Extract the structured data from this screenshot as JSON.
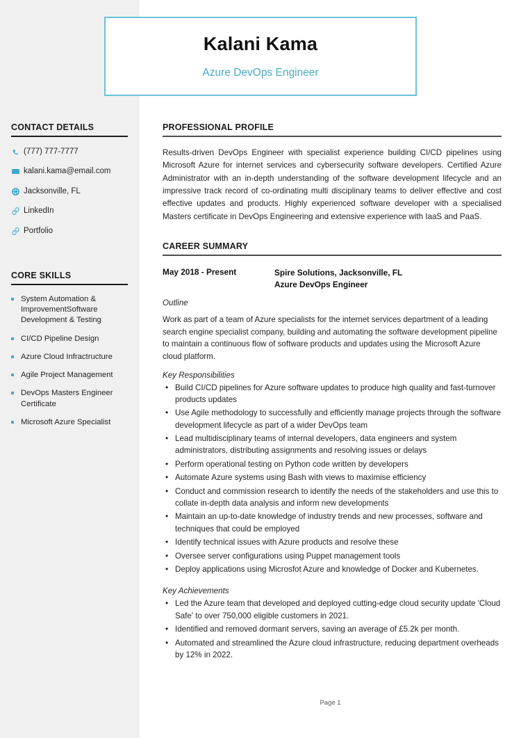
{
  "header": {
    "name": "Kalani Kama",
    "job_title": "Azure DevOps Engineer"
  },
  "accent_color": "#4aa8c4",
  "sidebar": {
    "contact_heading": "CONTACT DETAILS",
    "contact_items": [
      {
        "icon": "phone-icon",
        "value": "(777) 777-7777"
      },
      {
        "icon": "envelope-icon",
        "value": "kalani.kama@email.com"
      },
      {
        "icon": "globe-icon",
        "value": "Jacksonville, FL"
      },
      {
        "icon": "link-icon",
        "value": "LinkedIn"
      },
      {
        "icon": "link-icon",
        "value": "Portfolio"
      }
    ],
    "skills_heading": "CORE SKILLS",
    "skills": [
      "System Automation & ImprovementSoftware Development & Testing",
      "CI/CD Pipeline Design",
      "Azure Cloud Infractructure",
      "Agile Project Management",
      "DevOps Masters Engineer Certificate",
      "Microsoft Azure Specialist"
    ]
  },
  "main": {
    "profile_heading": "PROFESSIONAL PROFILE",
    "profile_text": "Results-driven DevOps Engineer with specialist experience building CI/CD pipelines using Microsoft Azure for internet services and cybersecurity software developers. Certified Azure Administrator with an in-depth understanding of the software development lifecycle and an impressive track record of co-ordinating multi disciplinary teams to deliver effective and cost effective updates and products. Highly experienced software developer with a specialised Masters certificate in DevOps Engineering and extensive experience with IaaS and PaaS.",
    "career_heading": "CAREER SUMMARY",
    "job": {
      "dates": "May 2018 - Present",
      "company": "Spire Solutions, Jacksonville, FL",
      "role": "Azure DevOps Engineer",
      "outline_label": "Outline",
      "outline_text": "Work as part of a team of Azure specialists for the internet services department of a leading search engine specialist company, building and automating the software development pipeline to maintain a continuous flow of software products and updates using the Microsoft Azure cloud platform.",
      "responsibilities_label": "Key Responsibilities",
      "responsibilities": [
        "Build CI/CD pipelines for Azure software updates to produce high quality and fast-turnover products updates",
        "Use Agile methodology to successfully and efficiently manage projects through the software development lifecycle as part of a wider DevOps team",
        "Lead multidisciplinary teams of internal developers, data engineers and system administrators, distributing assignments and resolving issues or delays",
        "Perform operational testing on Python code written by developers",
        "Automate Azure systems using Bash with views to maximise efficiency",
        "Conduct and commission research to identify the needs of the stakeholders and use this to collate in-depth data analysis and inform new developments",
        "Maintain an up-to-date knowledge of industry trends and new processes, software and techniques that could be employed",
        "Identify technical issues with Azure products and resolve these",
        "Oversee server configurations using Puppet management tools",
        "Deploy applications using Microsfot Azure and knowledge of Docker and Kubernetes."
      ],
      "achievements_label": "Key Achievements",
      "achievements": [
        "Led the Azure team that developed and deployed cutting-edge cloud security update 'Cloud Safe' to over 750,000 eligible customers in 2021.",
        "Identified and removed dormant servers, saving an average of £5.2k per month.",
        "Automated and streamlined the Azure cloud infrastructure, reducing department overheads by 12% in 2022."
      ]
    }
  },
  "footer": {
    "page_label": "Page 1"
  }
}
